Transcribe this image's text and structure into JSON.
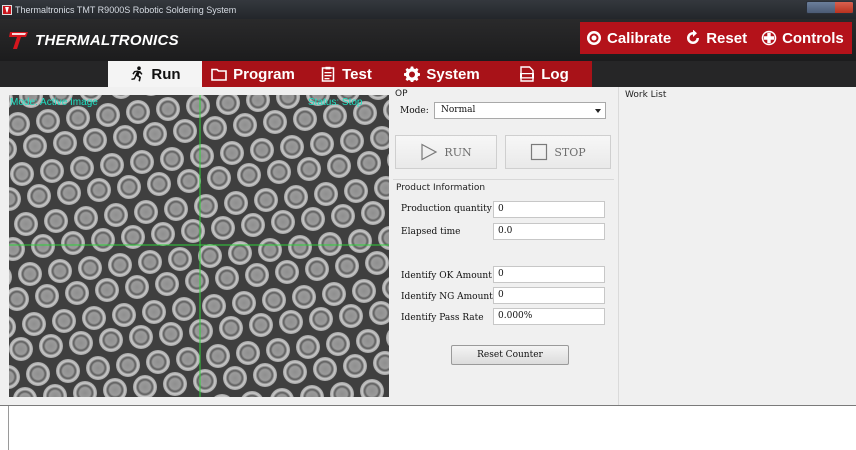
{
  "window": {
    "title": "Thermaltronics TMT R9000S Robotic Soldering System"
  },
  "brand": {
    "name": "THERMALTRONICS"
  },
  "actions": [
    {
      "label": "Calibrate",
      "icon": "target-icon"
    },
    {
      "label": "Reset",
      "icon": "refresh-icon"
    },
    {
      "label": "Controls",
      "icon": "dpad-icon"
    }
  ],
  "tabs": [
    {
      "label": "Run",
      "icon": "running-man-icon",
      "active": true
    },
    {
      "label": "Program",
      "icon": "folder-icon"
    },
    {
      "label": "Test",
      "icon": "clipboard-icon"
    },
    {
      "label": "System",
      "icon": "gear-icon"
    },
    {
      "label": "Log",
      "icon": "log-icon"
    }
  ],
  "camera": {
    "mode_label": "Mode: Active Image",
    "status_label": "Status: Stop"
  },
  "op": {
    "section_title": "OP",
    "mode_label": "Mode:",
    "mode_value": "Normal",
    "run_label": "RUN",
    "stop_label": "STOP"
  },
  "product_info": {
    "title": "Product Information",
    "rows": [
      {
        "label": "Production quantity",
        "value": "0"
      },
      {
        "label": "Elapsed time",
        "value": "0.0"
      },
      {
        "label": "Identify OK Amount",
        "value": "0"
      },
      {
        "label": "Identify NG Amount",
        "value": "0"
      },
      {
        "label": "Identify Pass Rate",
        "value": "0.000%"
      }
    ],
    "reset_label": "Reset Counter"
  },
  "work_list": {
    "title": "Work List"
  },
  "colors": {
    "brand_red": "#b4121a",
    "tab_red": "#a81218",
    "header_dark": "#1c1c1d",
    "overlay_cyan": "#1ee0c2",
    "crosshair_green": "#2fd13a"
  }
}
